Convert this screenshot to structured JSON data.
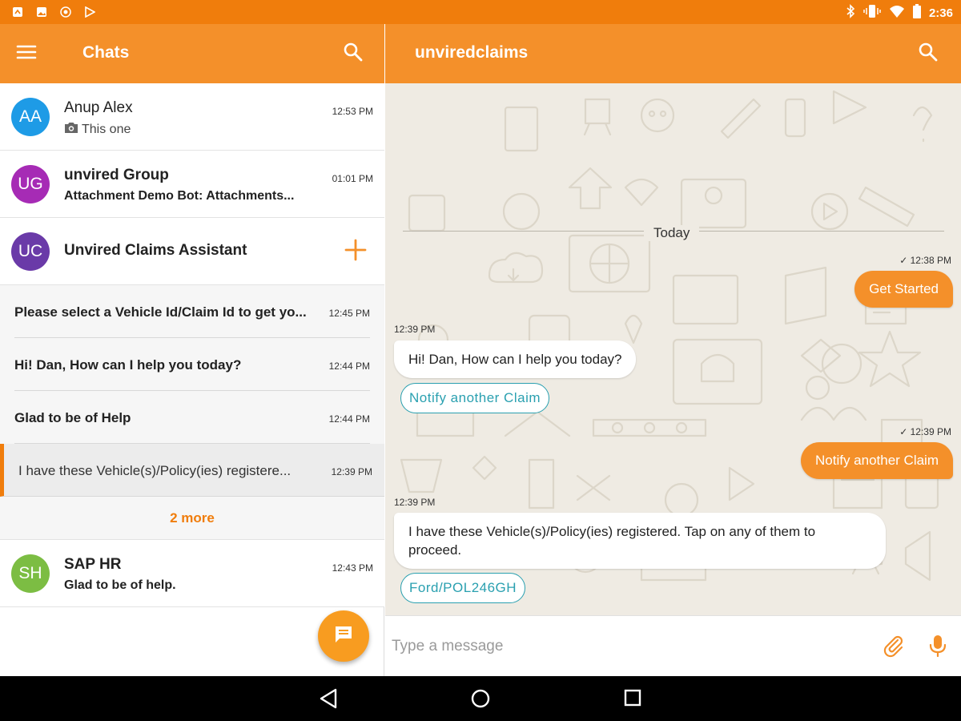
{
  "status_bar": {
    "time": "2:36",
    "icons": [
      "notification-icon",
      "image-icon",
      "camera-icon",
      "play-store-icon",
      "bluetooth-icon",
      "vibrate-icon",
      "wifi-icon",
      "battery-icon"
    ]
  },
  "colors": {
    "accent": "#f4902a",
    "status": "#f07d0c",
    "chip": "#2aa0b0",
    "avatar_aa": "#1e9be6",
    "avatar_ug": "#a62bb5",
    "avatar_uc": "#6a3aa8",
    "avatar_sh": "#7cbd43"
  },
  "left_header": {
    "title": "Chats"
  },
  "chats": [
    {
      "initials": "AA",
      "name": "Anup Alex",
      "preview": "This one",
      "time": "12:53 PM"
    },
    {
      "initials": "UG",
      "name": "unvired Group",
      "preview": "Attachment Demo Bot: Attachments...",
      "time": "01:01 PM"
    }
  ],
  "group": {
    "initials": "UC",
    "name": "Unvired Claims Assistant",
    "sub_items": [
      {
        "text": "Please select a Vehicle Id/Claim Id to get yo...",
        "time": "12:45 PM"
      },
      {
        "text": "Hi! Dan, How can I help you today?",
        "time": "12:44 PM"
      },
      {
        "text": "Glad to be of Help",
        "time": "12:44 PM"
      },
      {
        "text": "I have these Vehicle(s)/Policy(ies) registere...",
        "time": "12:39 PM"
      }
    ],
    "more_label": "2 more"
  },
  "chat_sap": {
    "initials": "SH",
    "name": "SAP HR",
    "preview": "Glad to be of help.",
    "time": "12:43 PM"
  },
  "conversation": {
    "title": "unviredclaims",
    "day_label": "Today",
    "messages": {
      "out1": {
        "meta": "✓ 12:38 PM",
        "text": "Get Started"
      },
      "in1": {
        "meta": "12:39 PM",
        "text": "Hi! Dan, How can I help you today?",
        "chip": "Notify another Claim"
      },
      "out2": {
        "meta": "✓ 12:39 PM",
        "text": "Notify another Claim"
      },
      "in2": {
        "meta": "12:39 PM",
        "text": "I have these Vehicle(s)/Policy(ies) registered. Tap on any of them to proceed.",
        "chip": "Ford/POL246GH"
      }
    },
    "compose_placeholder": "Type a message"
  }
}
